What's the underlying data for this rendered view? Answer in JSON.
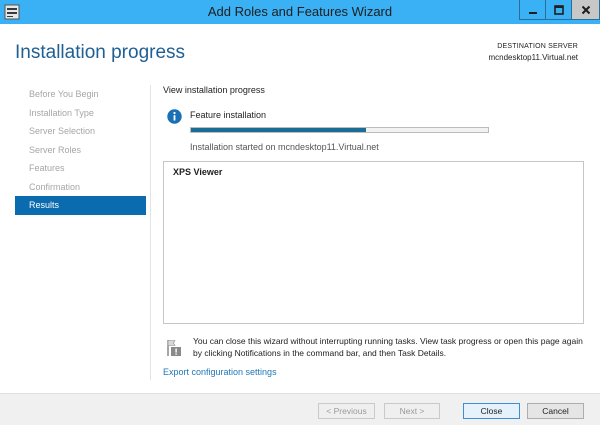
{
  "window": {
    "title": "Add Roles and Features Wizard",
    "titlebar_color": "#39b1f4"
  },
  "header": {
    "page_title": "Installation progress",
    "destination_label": "DESTINATION SERVER",
    "destination_server": "mcndesktop11.Virtual.net"
  },
  "sidebar": {
    "items": [
      {
        "label": "Before You Begin",
        "state": "inactive"
      },
      {
        "label": "Installation Type",
        "state": "inactive"
      },
      {
        "label": "Server Selection",
        "state": "inactive"
      },
      {
        "label": "Server Roles",
        "state": "inactive"
      },
      {
        "label": "Features",
        "state": "inactive"
      },
      {
        "label": "Confirmation",
        "state": "inactive"
      },
      {
        "label": "Results",
        "state": "active"
      }
    ]
  },
  "main": {
    "heading": "View installation progress",
    "feature_label": "Feature installation",
    "progress_fraction": 0.59,
    "status_text": "Installation started on mcndesktop11.Virtual.net",
    "results": [
      {
        "name": "XPS Viewer"
      }
    ],
    "note": "You can close this wizard without interrupting running tasks. View task progress or open this page again by clicking Notifications in the command bar, and then Task Details.",
    "export_link": "Export configuration settings"
  },
  "footer": {
    "previous_label": "< Previous",
    "next_label": "Next >",
    "close_label": "Close",
    "cancel_label": "Cancel"
  },
  "colors": {
    "accent": "#0a6bae",
    "heading": "#1f5f93",
    "progress": "#1a6e96",
    "link": "#1f77b6"
  },
  "icons": {
    "app": "server-manager-icon",
    "info": "info-icon",
    "note": "flag-note-icon"
  }
}
